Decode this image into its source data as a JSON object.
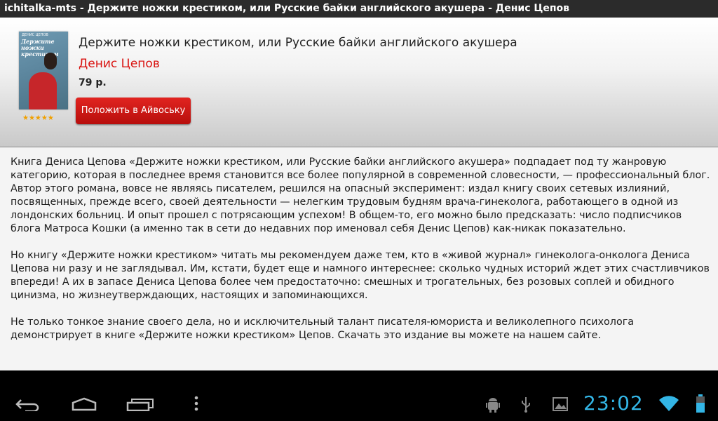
{
  "window": {
    "title": "ichitalka-mts - Держите ножки крестиком, или Русские байки английского акушера - Денис Цепов"
  },
  "book": {
    "title": "Держите ножки крестиком, или Русские байки английского акушера",
    "author": "Денис Цепов",
    "price": "79 р.",
    "rating": 5,
    "stars_display": "★★★★★",
    "buy_button_label": "Положить в Айвоську",
    "cover": {
      "top_text": "ДЕНИС ЦЕПОВ",
      "title_text": "Держите ножки крестиком"
    }
  },
  "description": {
    "paragraphs": [
      "Книга Дениса Цепова «Держите ножки крестиком, или Русские байки английского акушера» подпадает под ту жанровую категорию, которая в последнее время становится все более популярной в современной словесности, — профессиональный блог. Автор этого романа, вовсе не являясь писателем, решился на опасный эксперимент: издал книгу своих сетевых излияний, посвященных, прежде всего, своей деятельности — нелегким трудовым будням врача-гинеколога, работающего в одной из лондонских больниц. И опыт прошел с потрясающим успехом! В общем-то, его можно было предсказать: число подписчиков блога Матроса Кошки (а именно так в сети до недавних пор именовал себя Денис Цепов) как-никак показательно.",
      "Но книгу «Держите ножки крестиком» читать мы рекомендуем даже тем, кто в «живой журнал» гинеколога-онколога Дениса Цепова ни разу и не заглядывал. Им, кстати, будет еще и намного интереснее: сколько чудных историй ждет этих счастливчиков впереди! А их в запасе Дениса Цепова более чем предостаточно: смешных и трогательных, без розовых соплей и обидного цинизма, но жизнеутверждающих, настоящих и запоминающихся.",
      "Не только тонкое знание своего дела, но и исключительный талант писателя-юмориста и великолепного психолога демонстрирует в книге «Держите ножки крестиком» Цепов. Скачать это издание вы можете на нашем сайте."
    ]
  },
  "system_bar": {
    "clock": "23:02",
    "icons": [
      "back-icon",
      "home-icon",
      "recent-apps-icon",
      "menu-icon",
      "android-debug-icon",
      "usb-icon",
      "picture-icon",
      "wifi-icon",
      "battery-icon"
    ]
  },
  "colors": {
    "accent_red": "#d9120f",
    "clock_blue": "#33b5e5",
    "stars": "#f0a000"
  }
}
